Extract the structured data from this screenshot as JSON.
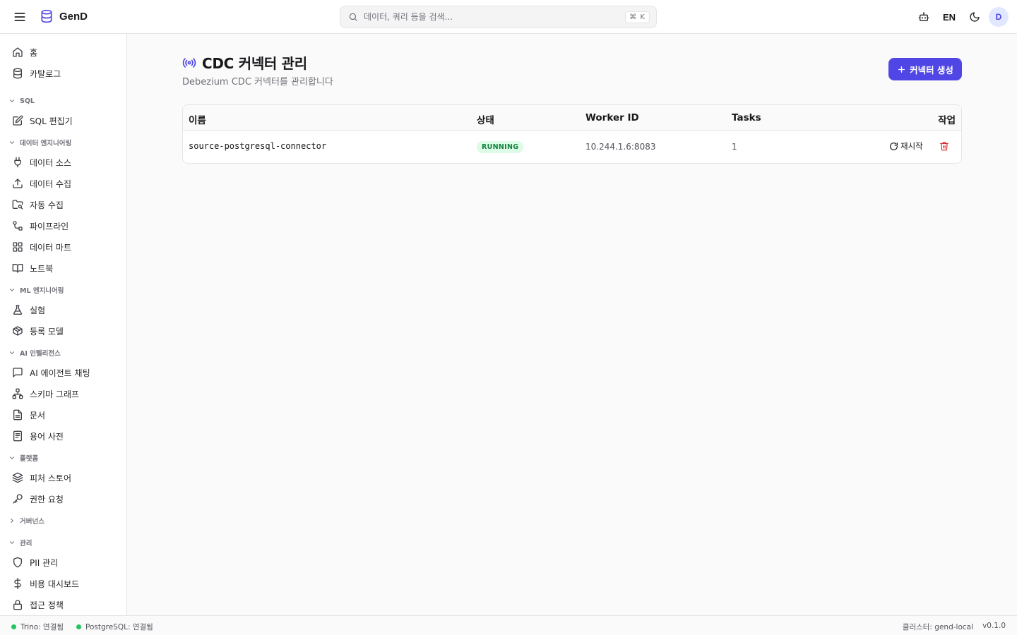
{
  "header": {
    "app_name": "GenD",
    "search_placeholder": "데이터, 쿼리 등을 검색...",
    "search_shortcut": "⌘ K",
    "language": "EN",
    "avatar_initial": "D"
  },
  "sidebar": {
    "items_top": [
      {
        "label": "홈",
        "icon": "home-icon"
      },
      {
        "label": "카탈로그",
        "icon": "database-icon"
      }
    ],
    "sections": [
      {
        "title": "SQL",
        "expanded": true,
        "items": [
          {
            "label": "SQL 편집기",
            "icon": "edit-icon"
          }
        ]
      },
      {
        "title": "데이터 엔지니어링",
        "expanded": true,
        "items": [
          {
            "label": "데이터 소스",
            "icon": "plug-icon"
          },
          {
            "label": "데이터 수집",
            "icon": "upload-icon"
          },
          {
            "label": "자동 수집",
            "icon": "folder-search-icon"
          },
          {
            "label": "파이프라인",
            "icon": "pipeline-icon"
          },
          {
            "label": "데이터 마트",
            "icon": "grid-icon"
          },
          {
            "label": "노트북",
            "icon": "book-icon"
          }
        ]
      },
      {
        "title": "ML 엔지니어링",
        "expanded": true,
        "items": [
          {
            "label": "실험",
            "icon": "flask-icon"
          },
          {
            "label": "등록 모델",
            "icon": "box-icon"
          }
        ]
      },
      {
        "title": "AI 인텔리전스",
        "expanded": true,
        "items": [
          {
            "label": "AI 에이전트 채팅",
            "icon": "chat-icon"
          },
          {
            "label": "스키마 그래프",
            "icon": "network-icon"
          },
          {
            "label": "문서",
            "icon": "file-icon"
          },
          {
            "label": "용어 사전",
            "icon": "dictionary-icon"
          }
        ]
      },
      {
        "title": "플랫폼",
        "expanded": true,
        "items": [
          {
            "label": "피처 스토어",
            "icon": "layers-icon"
          },
          {
            "label": "권한 요청",
            "icon": "key-icon"
          }
        ]
      },
      {
        "title": "거버넌스",
        "expanded": false,
        "items": []
      },
      {
        "title": "관리",
        "expanded": true,
        "items": [
          {
            "label": "PII 관리",
            "icon": "shield-icon"
          },
          {
            "label": "비용 대시보드",
            "icon": "dollar-icon"
          },
          {
            "label": "접근 정책",
            "icon": "lock-icon"
          }
        ]
      }
    ]
  },
  "main": {
    "title": "CDC 커넥터 관리",
    "subtitle": "Debezium CDC 커넥터를 관리합니다",
    "create_button": "커넥터 생성",
    "table": {
      "columns": [
        "이름",
        "상태",
        "Worker ID",
        "Tasks",
        "작업"
      ],
      "rows": [
        {
          "name": "source-postgresql-connector",
          "status": "RUNNING",
          "worker_id": "10.244.1.6:8083",
          "tasks": "1",
          "restart_label": "재시작"
        }
      ]
    }
  },
  "footer": {
    "trino_status": "Trino: 연결됨",
    "postgres_status": "PostgreSQL: 연결됨",
    "cluster": "클러스터: gend-local",
    "version": "v0.1.0"
  },
  "colors": {
    "accent": "#4f46e5",
    "status_running_bg": "#dcfce7",
    "status_running_text": "#15803d",
    "connected_dot": "#22c55e",
    "delete": "#dc2626"
  }
}
